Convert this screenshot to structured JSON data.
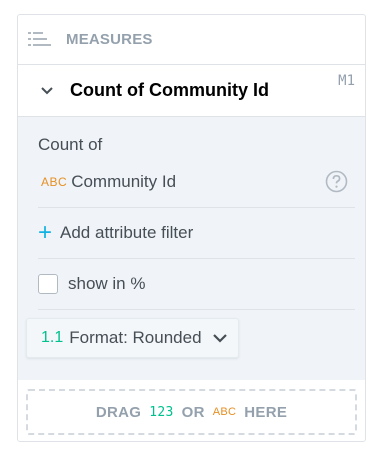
{
  "bucket": {
    "title": "MEASURES",
    "icon": "measures-icon"
  },
  "measure": {
    "title": "Count of Community Id",
    "sequence": "M1",
    "count_of_label": "Count of",
    "attribute_type_label": "ABC",
    "attribute_name": "Community Id",
    "add_filter_label": "Add attribute filter",
    "show_in_percent_label": "show in %",
    "show_in_percent_checked": false,
    "format_icon_label": "1.1",
    "format_label": "Format: Rounded"
  },
  "dropzone": {
    "drag_label": "DRAG",
    "number_label": "123",
    "or_label": "OR",
    "abc_label": "ABC",
    "here_label": "HERE"
  },
  "colors": {
    "accent_blue": "#14b2e2",
    "attribute_orange": "#e68f23",
    "metric_green": "#00c18e",
    "muted_gray": "#94a1ad",
    "border": "#dfe3e8",
    "body_bg": "#f0f4f8"
  }
}
